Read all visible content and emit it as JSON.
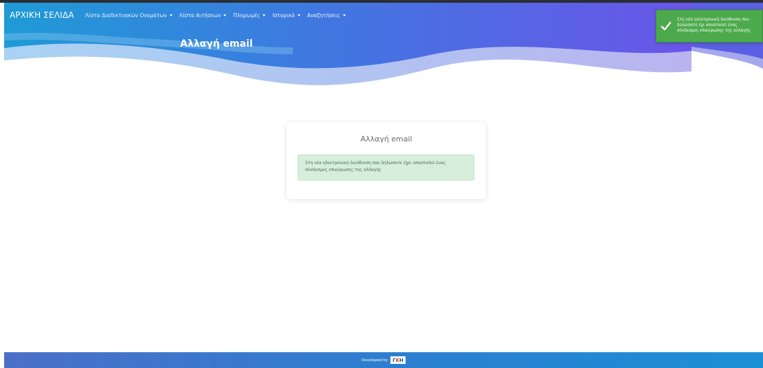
{
  "navbar": {
    "brand": "ΑΡΧΙΚΗ ΣΕΛΙΔΑ",
    "items": [
      {
        "label": "Λίστα Διαδικτυακών Ονομάτων"
      },
      {
        "label": "Λίστα Αιτήσεων"
      },
      {
        "label": "Πληρωμές"
      },
      {
        "label": "Ιστορικό"
      },
      {
        "label": "Αναζητήσεις"
      }
    ]
  },
  "page_title": "Αλλαγή email",
  "toast": {
    "message": "Στη νέα ηλεκτρονική διεύθυνση που δηλώσατε έχι αποσταλεί ένας σύνδεσμος επικύρωσης της αλλαγής",
    "icon": "check-icon",
    "color": "#4caa4c"
  },
  "card": {
    "title": "Αλλαγή email",
    "alert": "Στη νέα ηλεκτρονική διεύθυνση που δηλώσατε έχει αποσταλεί ένας σύνδεσμος επικύρωσης της αλλαγής"
  },
  "footer": {
    "text": "Developed by",
    "logo_left": "Γ",
    "logo_accent": "Κ",
    "logo_right": "Η"
  },
  "colors": {
    "hero_gradient_start": "#1f9bd6",
    "hero_gradient_end": "#6a55e0",
    "footer": "#2d7ecf",
    "alert_bg": "#d7eedb"
  }
}
